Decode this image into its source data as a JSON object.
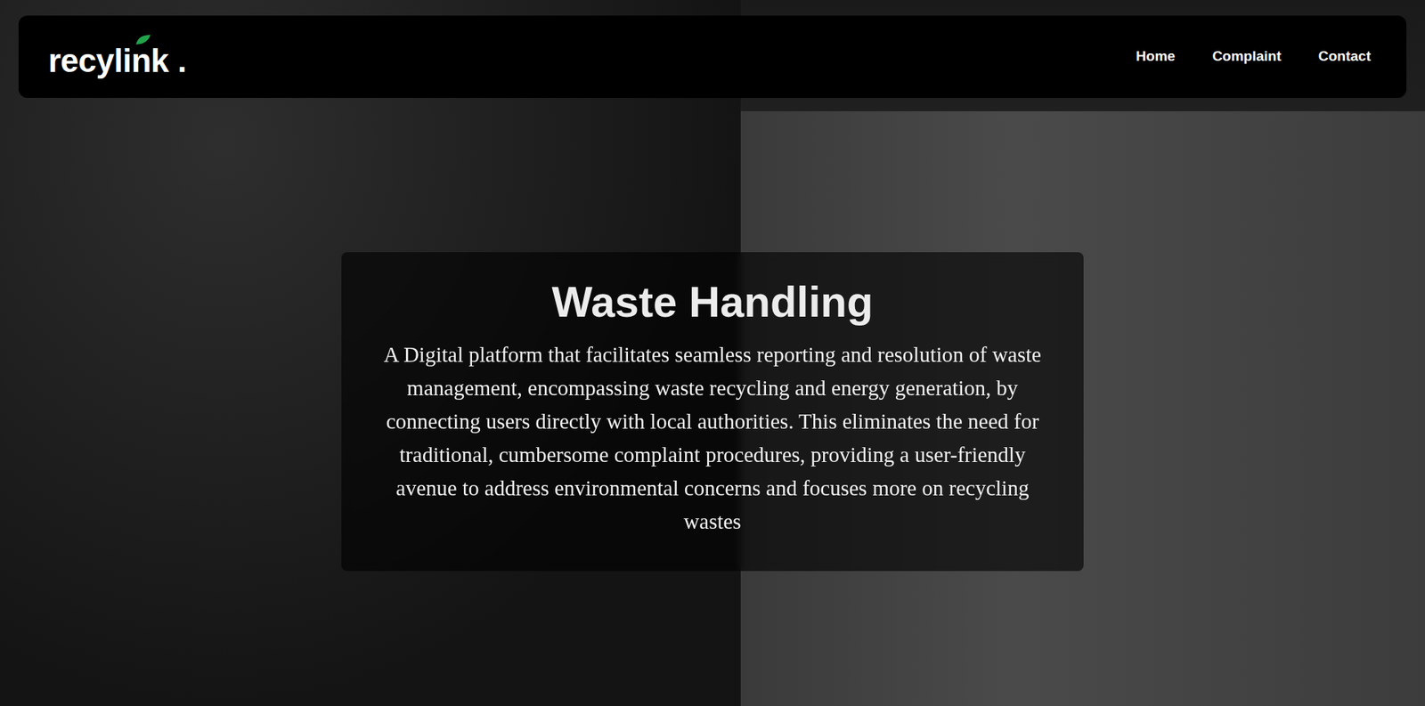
{
  "logo": {
    "text": "recylink",
    "dot": "."
  },
  "nav": [
    {
      "label": "Home"
    },
    {
      "label": "Complaint"
    },
    {
      "label": "Contact"
    }
  ],
  "hero": {
    "title": "Waste Handling",
    "description": "A Digital platform that facilitates seamless reporting and resolution of waste management, encompassing waste recycling and energy generation, by connecting users directly with local authorities. This eliminates the need for traditional, cumbersome complaint procedures, providing a user-friendly avenue to address environmental concerns and focuses more on recycling wastes"
  }
}
